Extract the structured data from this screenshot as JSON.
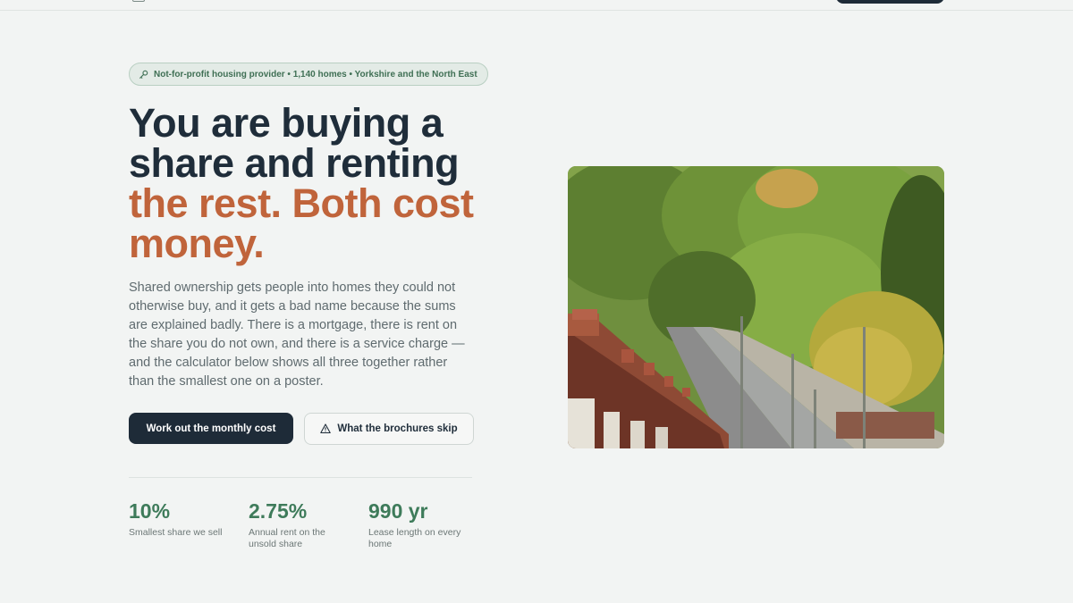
{
  "hero": {
    "badge": "Not-for-profit housing provider • 1,140 homes • Yorkshire and the North East",
    "headline_line1": "You are buying a",
    "headline_line2": "share and renting",
    "headline_accent_line1": "the rest. Both cost",
    "headline_accent_line2": "money.",
    "lede": "Shared ownership gets people into homes they could not otherwise buy, and it gets a bad name because the sums are explained badly. There is a mortgage, there is rent on the share you do not own, and there is a service charge — and the calculator below shows all three together rather than the smallest one on a poster.",
    "primary_cta": "Work out the monthly cost",
    "secondary_cta": "What the brochures skip",
    "photo_icon": "street-photo"
  },
  "stats": [
    {
      "value": "10%",
      "label": "Smallest share we sell"
    },
    {
      "value": "2.75%",
      "label": "Annual rent on the unsold share"
    },
    {
      "value": "990 yr",
      "label": "Lease length on every home"
    }
  ],
  "colors": {
    "background": "#f2f4f3",
    "ink": "#1f2d3a",
    "accent": "#c0643b",
    "green": "#3e7b5a",
    "button_dark": "#1e2b38"
  },
  "icons": {
    "badge": "key-icon",
    "secondary_cta": "warning-triangle-icon"
  }
}
